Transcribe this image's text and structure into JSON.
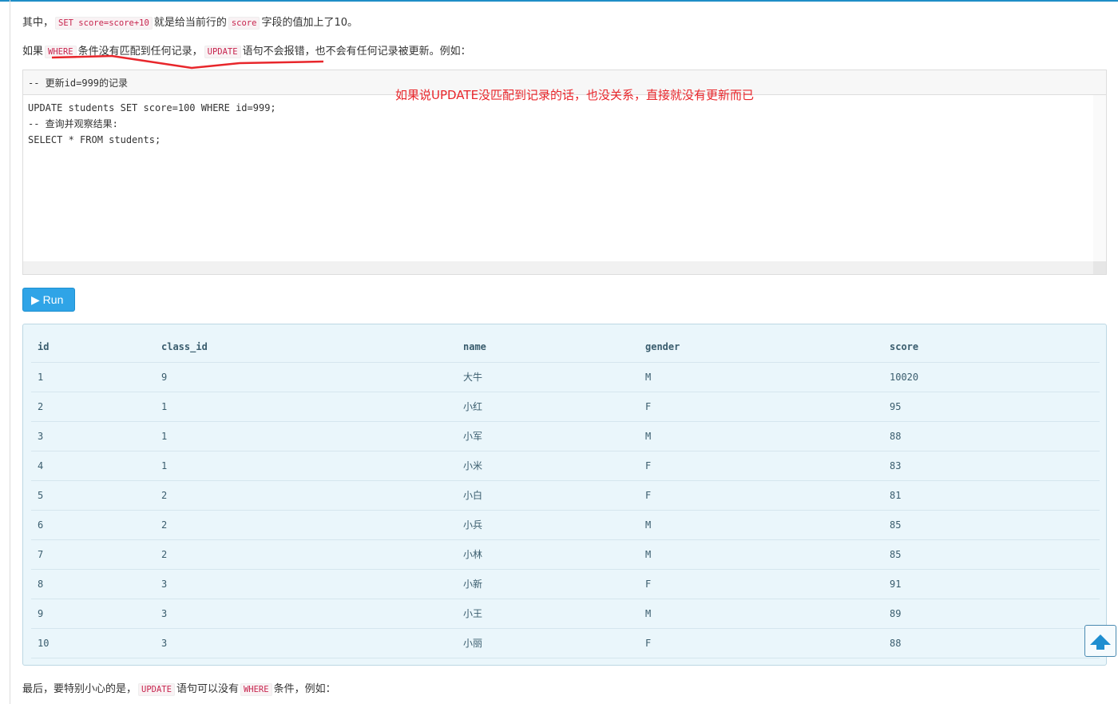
{
  "para1": {
    "prefix": "其中，",
    "code1": "SET score=score+10",
    "mid": "就是给当前行的",
    "code2": "score",
    "suffix": "字段的值加上了10。"
  },
  "para2": {
    "prefix": "如果",
    "code1": "WHERE",
    "mid": "条件没有匹配到任何记录，",
    "code2": "UPDATE",
    "suffix": "语句不会报错，也不会有任何记录被更新。例如："
  },
  "editor": {
    "header": "-- 更新id=999的记录",
    "lines": [
      "UPDATE students SET score=100 WHERE id=999;",
      "-- 查询并观察结果:",
      "SELECT * FROM students;"
    ]
  },
  "annotation": "如果说UPDATE没匹配到记录的话，也没关系，直接就没有更新而已",
  "annotation_color": "#e8262b",
  "run_button": {
    "label": "Run",
    "icon": "play-icon"
  },
  "result": {
    "columns": [
      "id",
      "class_id",
      "name",
      "gender",
      "score"
    ],
    "rows": [
      [
        "1",
        "9",
        "大牛",
        "M",
        "10020"
      ],
      [
        "2",
        "1",
        "小红",
        "F",
        "95"
      ],
      [
        "3",
        "1",
        "小军",
        "M",
        "88"
      ],
      [
        "4",
        "1",
        "小米",
        "F",
        "83"
      ],
      [
        "5",
        "2",
        "小白",
        "F",
        "81"
      ],
      [
        "6",
        "2",
        "小兵",
        "M",
        "85"
      ],
      [
        "7",
        "2",
        "小林",
        "M",
        "85"
      ],
      [
        "8",
        "3",
        "小新",
        "F",
        "91"
      ],
      [
        "9",
        "3",
        "小王",
        "M",
        "89"
      ],
      [
        "10",
        "3",
        "小丽",
        "F",
        "88"
      ]
    ]
  },
  "para3": {
    "prefix": "最后，要特别小心的是，",
    "code1": "UPDATE",
    "mid": "语句可以没有",
    "code2": "WHERE",
    "suffix": "条件，例如："
  },
  "back_to_top": {
    "icon": "arrow-up-icon"
  }
}
